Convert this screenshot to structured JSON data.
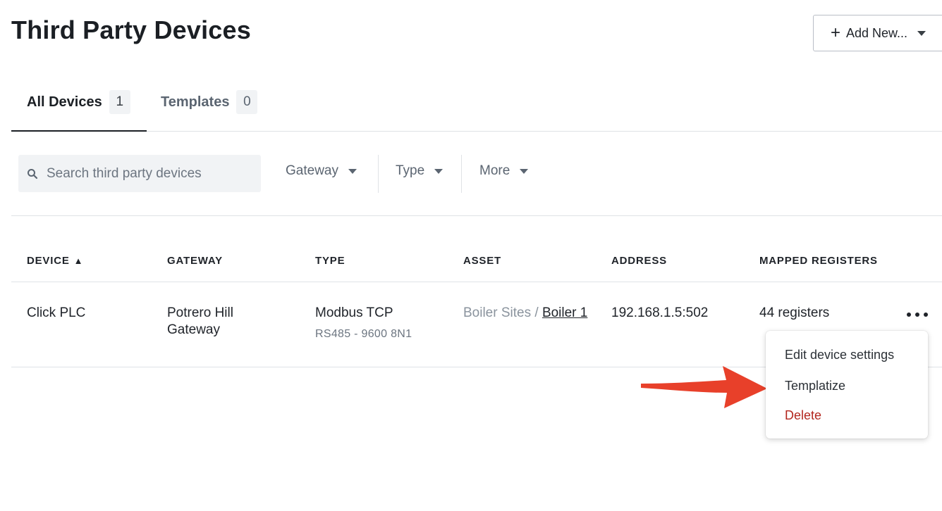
{
  "page": {
    "title": "Third Party Devices",
    "add_new_label": "Add New..."
  },
  "tabs": [
    {
      "label": "All Devices",
      "count": "1",
      "active": true
    },
    {
      "label": "Templates",
      "count": "0",
      "active": false
    }
  ],
  "filters": {
    "search_placeholder": "Search third party devices",
    "gateway_label": "Gateway",
    "type_label": "Type",
    "more_label": "More"
  },
  "table": {
    "columns": [
      "DEVICE",
      "GATEWAY",
      "TYPE",
      "ASSET",
      "ADDRESS",
      "MAPPED REGISTERS"
    ],
    "sort_indicator": "▲",
    "rows": [
      {
        "device": "Click PLC",
        "gateway": "Potrero Hill Gateway",
        "type": "Modbus TCP",
        "type_detail": "RS485 - 9600 8N1",
        "asset_parent": "Boiler Sites /",
        "asset_name": "Boiler 1",
        "address": "192.168.1.5:502",
        "mapped_registers": "44 registers"
      }
    ]
  },
  "context_menu": {
    "items": [
      {
        "label": "Edit device settings",
        "style": "normal"
      },
      {
        "label": "Templatize",
        "style": "normal"
      },
      {
        "label": "Delete",
        "style": "danger"
      }
    ]
  },
  "colors": {
    "danger": "#b3261e",
    "annotation_arrow": "#e8402a",
    "muted_text": "#5b6571"
  },
  "icons": {
    "search": "search-icon",
    "dropdown": "caret-down-icon",
    "row_menu": "more-horizontal-icon",
    "add": "plus-icon"
  }
}
